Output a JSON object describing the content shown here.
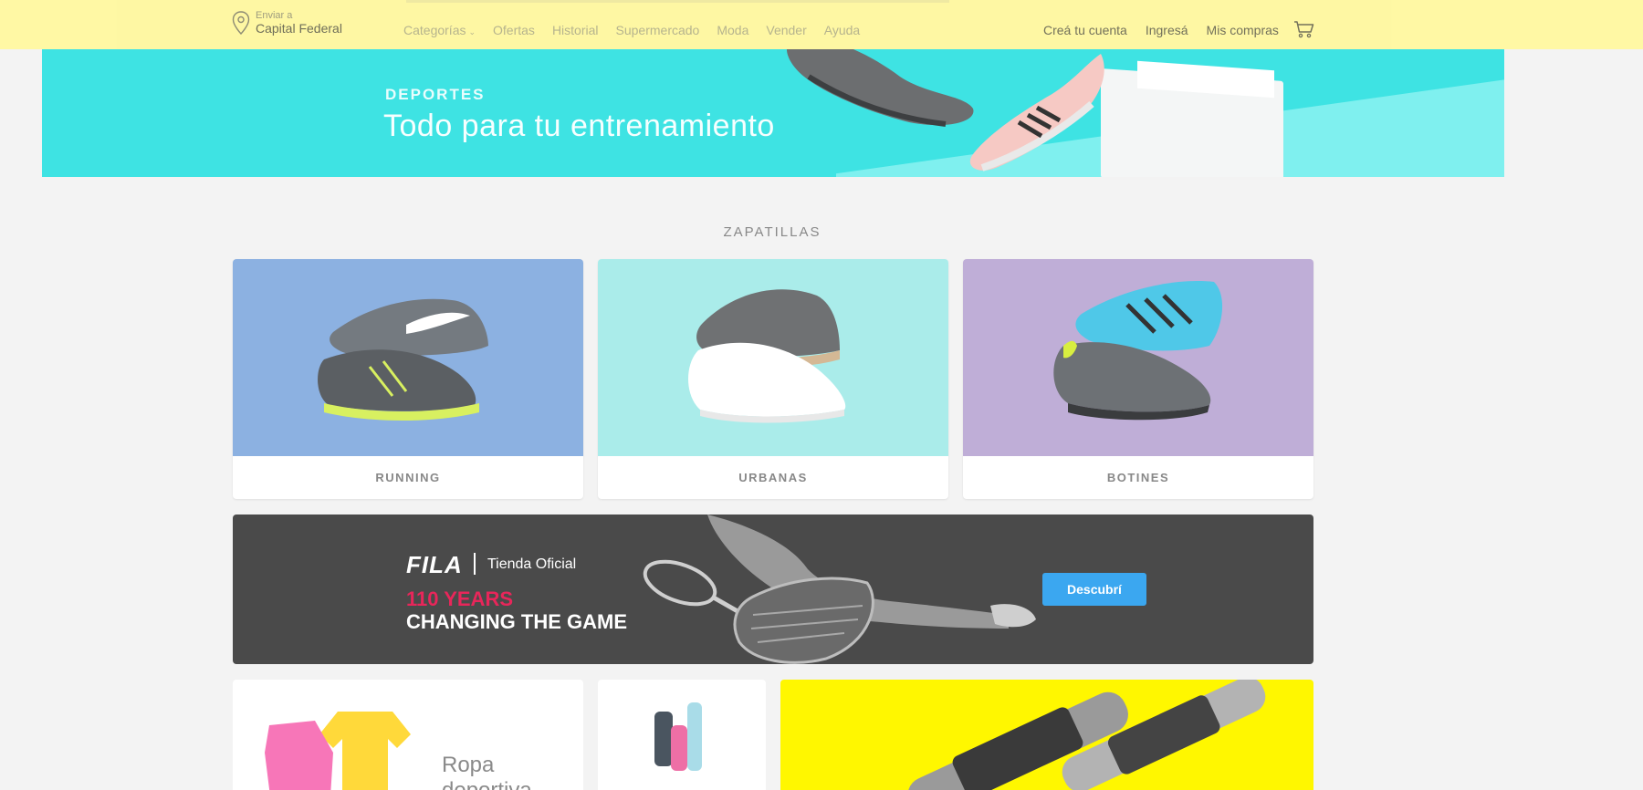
{
  "header": {
    "location": {
      "prefix": "Enviar a",
      "place": "Capital Federal"
    },
    "nav": [
      {
        "label": "Categorías",
        "has_dropdown": true
      },
      {
        "label": "Ofertas"
      },
      {
        "label": "Historial"
      },
      {
        "label": "Supermercado"
      },
      {
        "label": "Moda"
      },
      {
        "label": "Vender"
      },
      {
        "label": "Ayuda"
      }
    ],
    "account": [
      {
        "label": "Creá tu cuenta"
      },
      {
        "label": "Ingresá"
      },
      {
        "label": "Mis compras"
      }
    ],
    "cart_icon": "cart-icon"
  },
  "hero": {
    "kicker": "DEPORTES",
    "title": "Todo para tu entrenamiento"
  },
  "section": {
    "title": "ZAPATILLAS"
  },
  "cards": [
    {
      "label": "RUNNING"
    },
    {
      "label": "URBANAS"
    },
    {
      "label": "BOTINES"
    }
  ],
  "fila": {
    "brand": "FILA",
    "store": "Tienda Oficial",
    "years": "110 YEARS",
    "slogan": "CHANGING THE GAME",
    "button": "Descubrí"
  },
  "bottom": {
    "card1_caption_line1": "Ropa",
    "card1_caption_line2": "deportiva"
  },
  "colors": {
    "header_bg": "#fff8a1",
    "hero_bg": "#3ee3e3",
    "running_bg": "#8cb1e1",
    "urbanas_bg": "#aaecea",
    "botines_bg": "#bfaed7",
    "fila_bg": "#4a4a4a",
    "fila_accent": "#e8265a",
    "fila_button": "#3ba7f0",
    "promo_yellow": "#fff700"
  }
}
